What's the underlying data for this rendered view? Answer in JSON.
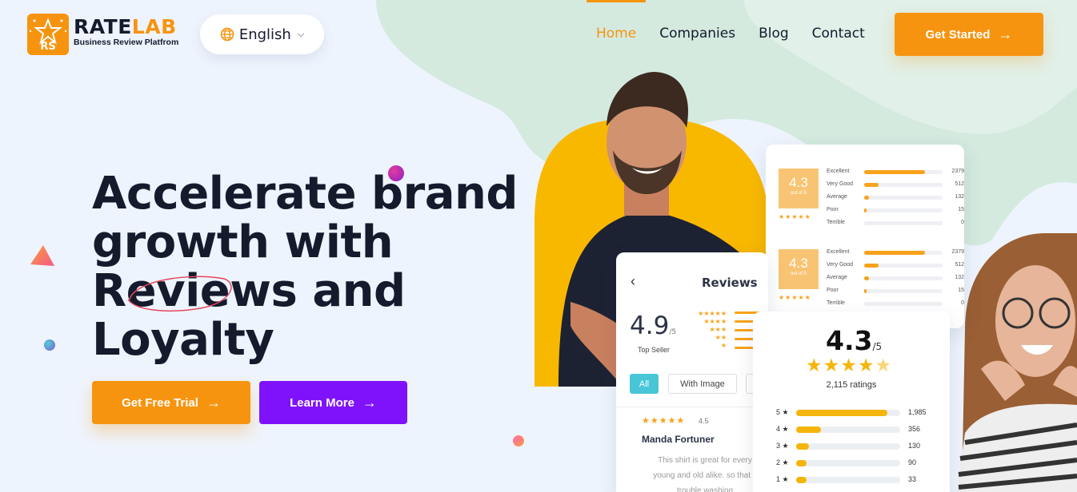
{
  "brand": {
    "badge_text": "RS",
    "name_part1": "RATE",
    "name_part2": "LAB",
    "tagline": "Business Review Platfrom"
  },
  "language": {
    "selected": "English"
  },
  "nav": {
    "items": [
      {
        "label": "Home",
        "active": true
      },
      {
        "label": "Companies",
        "active": false
      },
      {
        "label": "Blog",
        "active": false
      },
      {
        "label": "Contact",
        "active": false
      }
    ]
  },
  "header": {
    "cta_label": "Get Started"
  },
  "hero": {
    "title_lines": [
      "Accelerate brand",
      "growth with",
      "Reviews and",
      "Loyalty"
    ],
    "primary_cta": "Get Free Trial",
    "secondary_cta": "Learn More"
  },
  "rating_summary_card": {
    "blocks": [
      {
        "score": "4.3",
        "score_caption": "out of 5",
        "stars": "★★★★★",
        "rows": [
          {
            "label": "Excellent",
            "count": "2379",
            "fill": 0.78
          },
          {
            "label": "Very Good",
            "count": "512",
            "fill": 0.18
          },
          {
            "label": "Average",
            "count": "132",
            "fill": 0.06
          },
          {
            "label": "Poor",
            "count": "15",
            "fill": 0.03
          },
          {
            "label": "Terrible",
            "count": "0",
            "fill": 0.0
          }
        ]
      },
      {
        "score": "4.3",
        "score_caption": "out of 5",
        "stars": "★★★★★",
        "rows": [
          {
            "label": "Excellent",
            "count": "2379",
            "fill": 0.78
          },
          {
            "label": "Very Good",
            "count": "512",
            "fill": 0.18
          },
          {
            "label": "Average",
            "count": "132",
            "fill": 0.06
          },
          {
            "label": "Poor",
            "count": "15",
            "fill": 0.03
          },
          {
            "label": "Terrible",
            "count": "0",
            "fill": 0.0
          }
        ]
      }
    ]
  },
  "reviews_card": {
    "back_icon": "‹",
    "title": "Reviews",
    "score": "4.9",
    "score_max": "/5",
    "badge": "Top Seller",
    "tabs": [
      "All",
      "With Image",
      ""
    ],
    "review": {
      "stars": "★★★★★",
      "score": "4.5",
      "name": "Manda Fortuner",
      "body_lines": [
        "This shirt is great for every",
        "young and old alike. so that y",
        "trouble washing"
      ]
    }
  },
  "ratings_card": {
    "score": "4.3",
    "score_max": "/5",
    "stars": "★★★★",
    "half_star": "★",
    "count_label": "2,115 ratings",
    "rows": [
      {
        "label": "5 ★",
        "count": "1,985",
        "fill": 0.88
      },
      {
        "label": "4 ★",
        "count": "356",
        "fill": 0.24
      },
      {
        "label": "3 ★",
        "count": "130",
        "fill": 0.12
      },
      {
        "label": "2 ★",
        "count": "90",
        "fill": 0.1
      },
      {
        "label": "1 ★",
        "count": "33",
        "fill": 0.1
      }
    ]
  },
  "colors": {
    "accent": "#f7940f",
    "purple": "#7f12fb",
    "dark": "#141b2d",
    "mint": "#d4eadf",
    "yellow": "#f9b800"
  }
}
